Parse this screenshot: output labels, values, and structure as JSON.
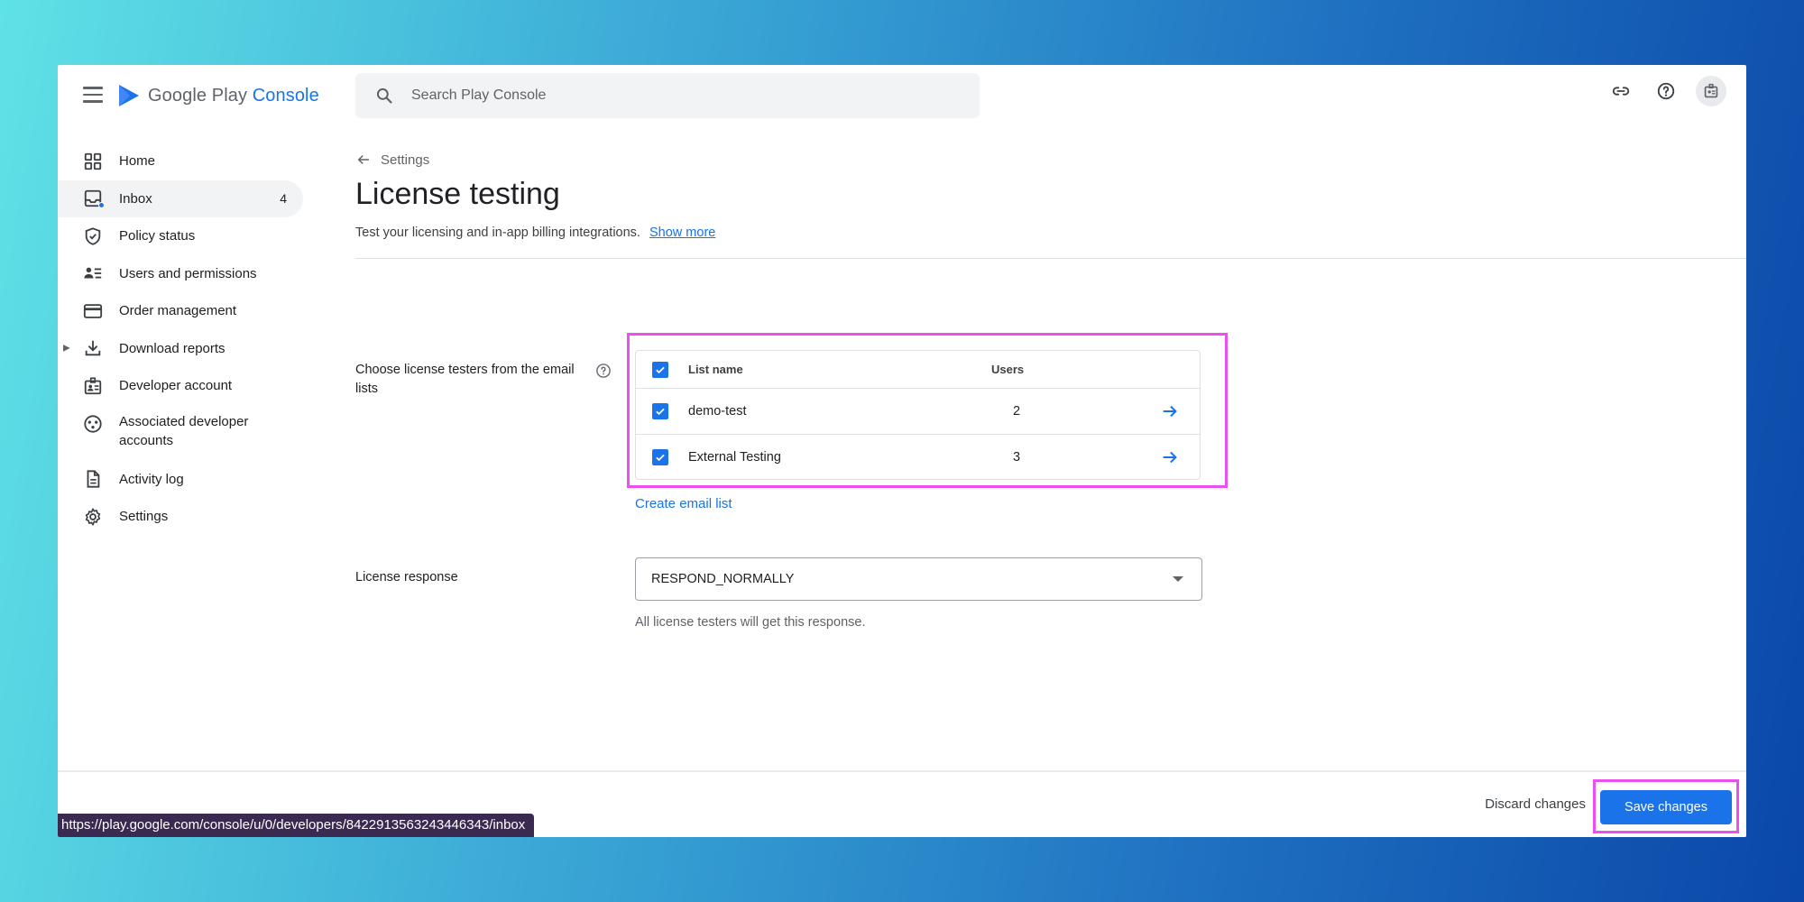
{
  "app": {
    "logo_text_main": "Google Play",
    "logo_text_accent": "Console",
    "brand_color": "#1a73e8",
    "highlight_color": "#ec4ef0"
  },
  "search": {
    "placeholder": "Search Play Console",
    "icon": "search-icon"
  },
  "top_icons": [
    "link-icon",
    "help-icon",
    "account-icon"
  ],
  "sidebar": {
    "items": [
      {
        "label": "Home",
        "icon": "home-grid-icon"
      },
      {
        "label": "Inbox",
        "icon": "inbox-icon",
        "badge": "4",
        "active": true
      },
      {
        "label": "Policy status",
        "icon": "shield-icon"
      },
      {
        "label": "Users and permissions",
        "icon": "users-icon"
      },
      {
        "label": "Order management",
        "icon": "credit-card-icon"
      },
      {
        "label": "Download reports",
        "icon": "download-icon",
        "expandable": true
      },
      {
        "label": "Developer account",
        "icon": "badge-icon"
      },
      {
        "label": "Associated developer accounts",
        "icon": "linked-accounts-icon"
      },
      {
        "label": "Activity log",
        "icon": "document-icon"
      },
      {
        "label": "Settings",
        "icon": "gear-icon"
      }
    ]
  },
  "main": {
    "back_label": "Settings",
    "title": "License testing",
    "subtitle": "Test your licensing and in-app billing integrations.",
    "show_more": "Show more",
    "testers_label": "Choose license testers from the email lists",
    "table": {
      "headers": {
        "name": "List name",
        "users": "Users"
      },
      "rows": [
        {
          "name": "demo-test",
          "users": "2",
          "checked": true
        },
        {
          "name": "External Testing",
          "users": "3",
          "checked": true
        }
      ]
    },
    "create_link": "Create email list",
    "response_label": "License response",
    "response_value": "RESPOND_NORMALLY",
    "response_helper": "All license testers will get this response."
  },
  "footer": {
    "discard_label": "Discard changes",
    "save_label": "Save changes"
  },
  "status_bar": {
    "url": "https://play.google.com/console/u/0/developers/8422913563243446343/inbox"
  }
}
